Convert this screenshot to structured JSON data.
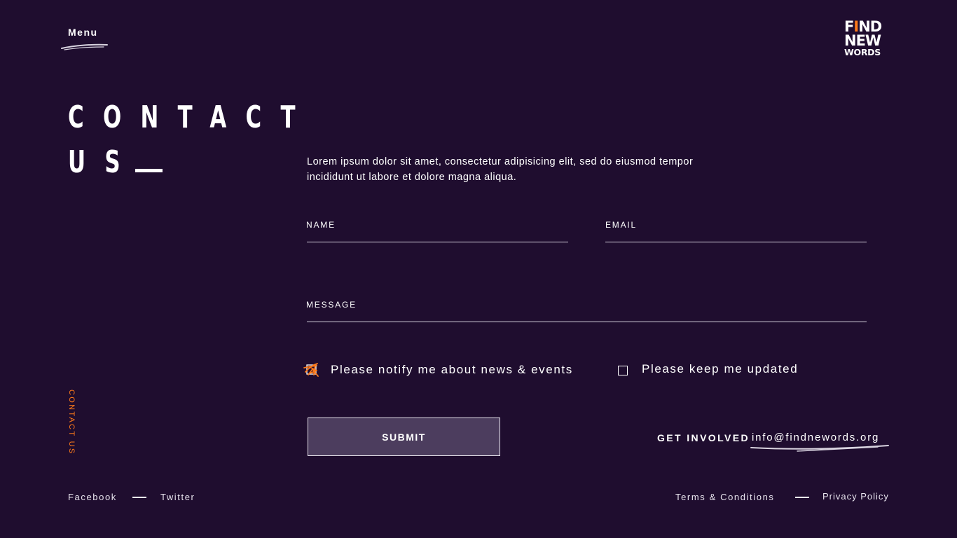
{
  "header": {
    "menu_label": "Menu",
    "logo": {
      "line1_a": "F",
      "line1_dot": "I",
      "line1_b": "ND",
      "line2": "NEW",
      "line3": "WORDS"
    }
  },
  "title": {
    "line1": "CONTACT",
    "line2": "US"
  },
  "intro": {
    "text": "Lorem ipsum dolor sit amet, consectetur adipisicing elit, sed do eiusmod tempor incididunt ut labore et dolore magna aliqua."
  },
  "form": {
    "name_label": "NAME",
    "name_value": "",
    "email_label": "EMAIL",
    "email_value": "",
    "message_label": "MESSAGE",
    "message_value": "",
    "checkboxes": [
      {
        "label": "Please notify me about news & events",
        "checked": true
      },
      {
        "label": "Please keep me updated",
        "checked": false
      }
    ],
    "submit_label": "SUBMIT"
  },
  "get_involved": {
    "label": "GET INVOLVED",
    "email": "info@findnewords.org"
  },
  "side_label": "CONTACT US",
  "footer": {
    "social": [
      "Facebook",
      "Twitter"
    ],
    "legal": [
      "Terms & Conditions",
      "Privacy Policy"
    ]
  },
  "colors": {
    "background": "#1f0d2f",
    "accent": "#ff7a1a",
    "button_bg": "#4c3d5e",
    "text": "#ffffff"
  },
  "icons": {
    "check_mark": "scribble-check-icon"
  }
}
